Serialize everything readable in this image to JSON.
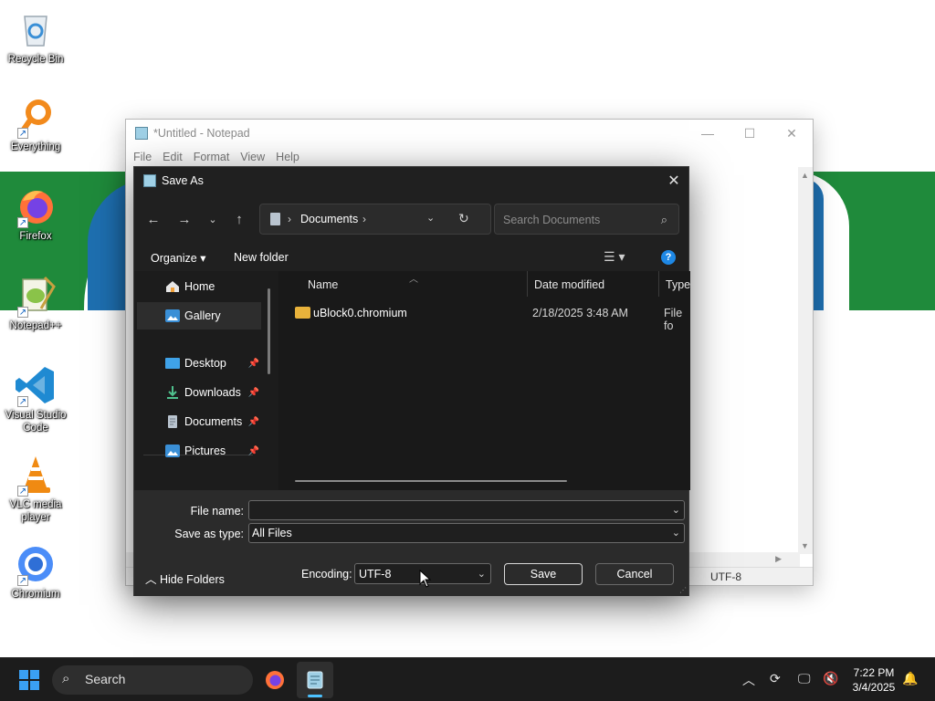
{
  "desktop": {
    "icons": [
      {
        "label": "Recycle Bin",
        "icon": "recycle-bin-icon"
      },
      {
        "label": "Everything",
        "icon": "search-magnifier-icon"
      },
      {
        "label": "Firefox",
        "icon": "firefox-icon"
      },
      {
        "label": "Notepad++",
        "icon": "notepad-plus-plus-icon"
      },
      {
        "label": "Visual Studio Code",
        "icon": "vscode-icon"
      },
      {
        "label": "VLC media player",
        "icon": "vlc-cone-icon"
      },
      {
        "label": "Chromium",
        "icon": "chromium-icon"
      }
    ]
  },
  "notepad": {
    "title": "*Untitled - Notepad",
    "menu": [
      "File",
      "Edit",
      "Format",
      "View",
      "Help"
    ],
    "status_encoding": "UTF-8"
  },
  "dialog": {
    "title": "Save As",
    "address": {
      "folder": "Documents"
    },
    "search_placeholder": "Search Documents",
    "commands": {
      "organize": "Organize",
      "new_folder": "New folder"
    },
    "nav": [
      {
        "label": "Home",
        "pinned": false
      },
      {
        "label": "Gallery",
        "pinned": false,
        "selected": true
      },
      {
        "label": "Desktop",
        "pinned": true
      },
      {
        "label": "Downloads",
        "pinned": true
      },
      {
        "label": "Documents",
        "pinned": true
      },
      {
        "label": "Pictures",
        "pinned": true
      }
    ],
    "columns": {
      "name": "Name",
      "date": "Date modified",
      "type": "Type"
    },
    "files": [
      {
        "name": "uBlock0.chromium",
        "date": "2/18/2025 3:48 AM",
        "type": "File fo"
      }
    ],
    "file_name_label": "File name:",
    "file_name_value": "",
    "save_type_label": "Save as type:",
    "save_type_value": "All Files",
    "hide_folders": "Hide Folders",
    "encoding_label": "Encoding:",
    "encoding_value": "UTF-8",
    "save_button": "Save",
    "cancel_button": "Cancel"
  },
  "taskbar": {
    "search_label": "Search",
    "time": "7:22 PM",
    "date": "3/4/2025"
  },
  "colors": {
    "accent": "#1e88e5",
    "wallpaper_green": "#1f8a3b",
    "wallpaper_blue": "#1e6fb0"
  }
}
